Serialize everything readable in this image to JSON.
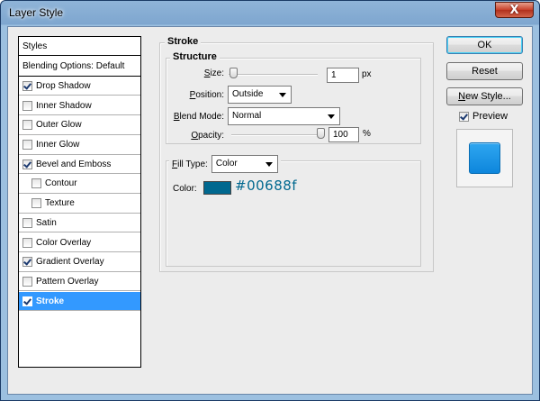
{
  "window": {
    "title": "Layer Style",
    "close_label": "X"
  },
  "styles_list": [
    {
      "label": "Styles",
      "checkbox": false,
      "checked": false,
      "head": true
    },
    {
      "label": "Blending Options: Default",
      "checkbox": false,
      "checked": false,
      "head": true
    },
    {
      "label": "Drop Shadow",
      "checkbox": true,
      "checked": true
    },
    {
      "label": "Inner Shadow",
      "checkbox": true,
      "checked": false
    },
    {
      "label": "Outer Glow",
      "checkbox": true,
      "checked": false
    },
    {
      "label": "Inner Glow",
      "checkbox": true,
      "checked": false
    },
    {
      "label": "Bevel and Emboss",
      "checkbox": true,
      "checked": true
    },
    {
      "label": "Contour",
      "checkbox": true,
      "checked": false,
      "indent": true
    },
    {
      "label": "Texture",
      "checkbox": true,
      "checked": false,
      "indent": true
    },
    {
      "label": "Satin",
      "checkbox": true,
      "checked": false
    },
    {
      "label": "Color Overlay",
      "checkbox": true,
      "checked": false
    },
    {
      "label": "Gradient Overlay",
      "checkbox": true,
      "checked": true
    },
    {
      "label": "Pattern Overlay",
      "checkbox": true,
      "checked": false
    },
    {
      "label": "Stroke",
      "checkbox": true,
      "checked": true,
      "selected": true
    }
  ],
  "stroke": {
    "section_title": "Stroke",
    "structure_title": "Structure",
    "size_label": "Size:",
    "size_value": "1",
    "size_unit": "px",
    "size_level": 0.01,
    "position_label": "Position:",
    "position_value": "Outside",
    "blend_label": "Blend Mode:",
    "blend_value": "Normal",
    "opacity_label": "Opacity:",
    "opacity_value": "100",
    "opacity_unit": "%",
    "opacity_level": 1.0,
    "fill_type_label": "Fill Type:",
    "fill_type_value": "Color",
    "color_label": "Color:",
    "color_hex": "#00688f"
  },
  "buttons": {
    "ok": "OK",
    "reset": "Reset",
    "new_style": "New Style..."
  },
  "preview": {
    "label": "Preview",
    "checked": true,
    "swatch_color": "#1a96e6"
  }
}
